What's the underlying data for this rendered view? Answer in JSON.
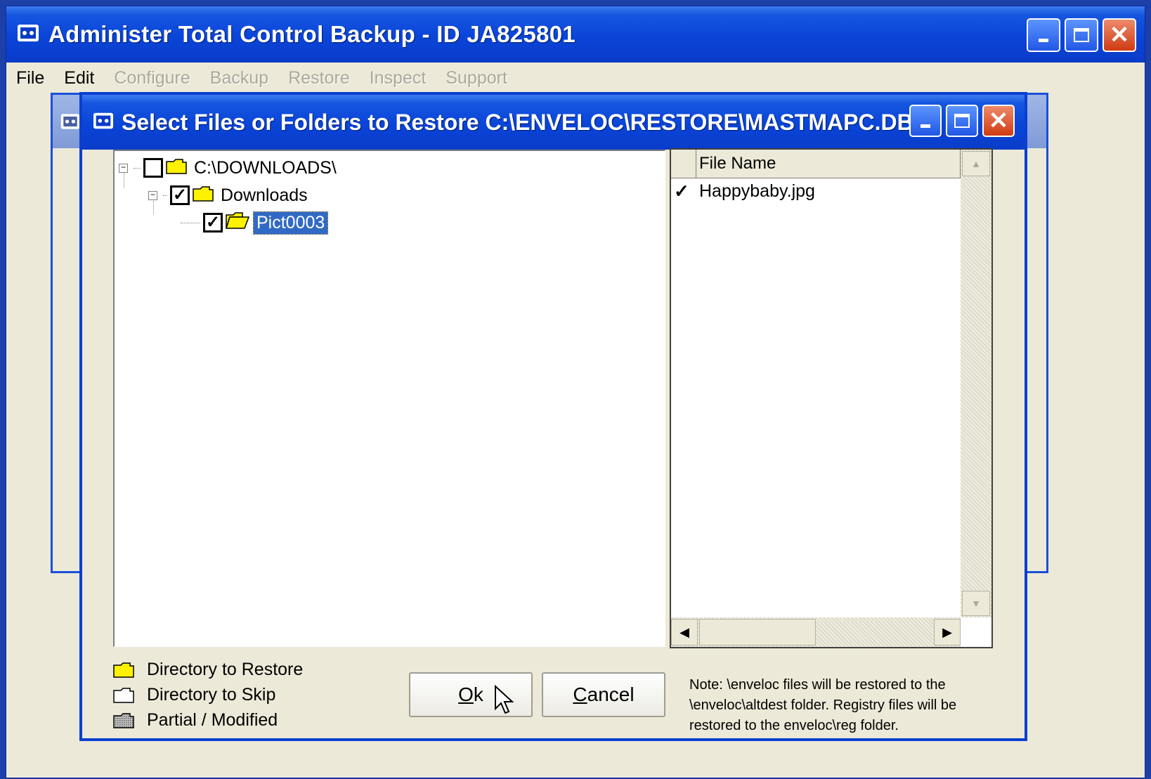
{
  "main_window": {
    "title": "Administer Total Control Backup - ID JA825801",
    "menu": [
      {
        "label": "File",
        "enabled": true
      },
      {
        "label": "Edit",
        "enabled": true
      },
      {
        "label": "Configure",
        "enabled": false
      },
      {
        "label": "Backup",
        "enabled": false
      },
      {
        "label": "Restore",
        "enabled": false
      },
      {
        "label": "Inspect",
        "enabled": false
      },
      {
        "label": "Support",
        "enabled": false
      }
    ]
  },
  "dialog": {
    "title": "Select Files or Folders to Restore C:\\ENVELOC\\RESTORE\\MASTMAPC.DBF",
    "tree": {
      "root": {
        "label": "C:\\DOWNLOADS\\",
        "checked": false
      },
      "child": {
        "label": "Downloads",
        "checked": true
      },
      "grandchild": {
        "label": "Pict0003",
        "checked": true,
        "selected": true
      }
    },
    "file_list": {
      "header": "File Name",
      "rows": [
        {
          "name": "Happybaby.jpg",
          "checked": true
        }
      ]
    },
    "legend": {
      "restore": "Directory to Restore",
      "skip": "Directory to Skip",
      "partial": "Partial / Modified"
    },
    "buttons": {
      "ok_rest": "k",
      "ok_mnemonic": "O",
      "cancel_mnemonic": "C",
      "cancel_rest": "ancel"
    },
    "note": "Note: \\enveloc files will be restored to the \\enveloc\\altdest folder.  Registry files will be restored to the enveloc\\reg folder."
  },
  "colors": {
    "title_blue": "#0a44d8",
    "folder_yellow": "#fff200",
    "selection": "#316ac5"
  }
}
